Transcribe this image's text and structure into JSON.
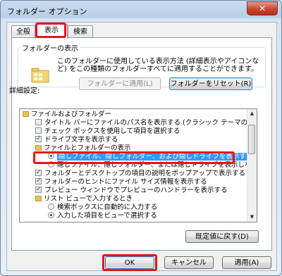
{
  "window": {
    "title": "フォルダー オプション",
    "close_label": "✕"
  },
  "tabs": [
    {
      "label": "全般"
    },
    {
      "label": "表示"
    },
    {
      "label": "検索"
    }
  ],
  "folder_view": {
    "legend": "フォルダーの表示",
    "description": "このフォルダーに使用している表示方法 (詳細表示やアイコンなど) をこの種類のフォルダーすべてに適用することができます。",
    "apply_button": "フォルダーに適用(L)",
    "reset_button": "フォルダーをリセット(R)"
  },
  "advanced": {
    "label": "詳細設定:",
    "items": [
      {
        "type": "folder",
        "text": "ファイルおよびフォルダー"
      },
      {
        "type": "checkbox",
        "checked": false,
        "text": "タイトル バーにファイルのパス名を表示する (クラシック テーマのみ)"
      },
      {
        "type": "checkbox",
        "checked": false,
        "text": "チェック ボックスを使用して項目を選択する"
      },
      {
        "type": "checkbox",
        "checked": true,
        "text": "ドライブ文字を表示する"
      },
      {
        "type": "folder",
        "text": "ファイルとフォルダーの表示"
      },
      {
        "type": "radio",
        "checked": true,
        "selected": true,
        "text": "隠しファイル、隠しフォルダー、および隠しドライブを表示する"
      },
      {
        "type": "radio",
        "checked": false,
        "text": "隠しファイル、隠しフォルダー、または隠しドライブを表示しない"
      },
      {
        "type": "checkbox",
        "checked": true,
        "text": "フォルダーとデスクトップの項目の説明をポップアップで表示する"
      },
      {
        "type": "checkbox",
        "checked": true,
        "text": "フォルダーのヒントにファイル サイズ情報を表示する"
      },
      {
        "type": "checkbox",
        "checked": true,
        "text": "プレビュー ウィンドウでプレビューのハンドラーを表示する"
      },
      {
        "type": "folder",
        "text": "リスト ビューで入力するとき"
      },
      {
        "type": "radio",
        "checked": false,
        "text": "検索ボックスに自動的に入力する"
      },
      {
        "type": "radio",
        "checked": true,
        "text": "入力した項目をビューで選択する"
      }
    ],
    "restore_button": "既定値に戻す(D)"
  },
  "footer": {
    "ok": "OK",
    "cancel": "キャンセル",
    "apply": "適用(A)"
  }
}
